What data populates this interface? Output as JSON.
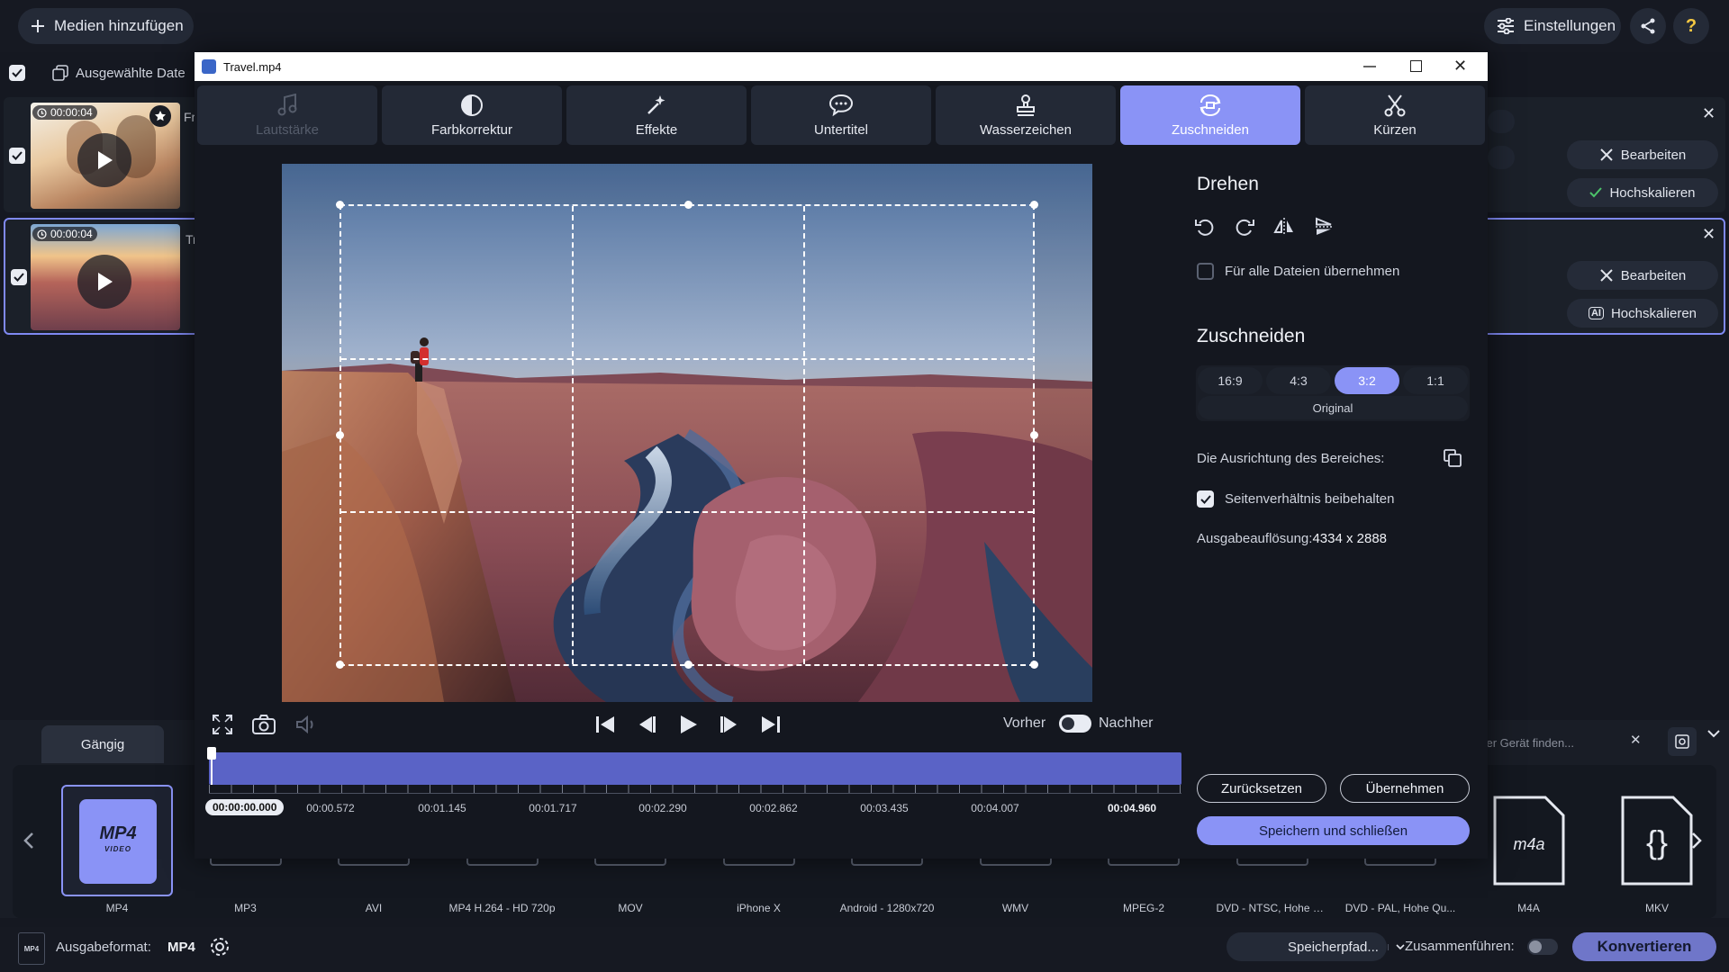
{
  "app": {
    "add_media": "Medien hinzufügen",
    "settings": "Einstellungen",
    "select_all": "Ausgewählte Date",
    "files": [
      {
        "duration": "00:00:04",
        "name": "Fr",
        "edit": "Bearbeiten",
        "upscale": "Hochskalieren"
      },
      {
        "duration": "00:00:04",
        "name": "Tr",
        "edit": "Bearbeiten",
        "upscale": "Hochskalieren"
      }
    ],
    "search_placeholder": "oder Gerät finden...",
    "tab_common": "Gängig",
    "formats": [
      {
        "label": "MP4",
        "icon": "mp4-video-icon"
      },
      {
        "label": "MP3",
        "icon": "mp3-icon"
      },
      {
        "label": "AVI",
        "icon": "avi-icon"
      },
      {
        "label": "MP4 H.264 - HD 720p",
        "icon": "hd-icon"
      },
      {
        "label": "MOV",
        "icon": "mov-icon"
      },
      {
        "label": "iPhone X",
        "icon": "iphone-icon"
      },
      {
        "label": "Android - 1280x720",
        "icon": "android-icon"
      },
      {
        "label": "WMV",
        "icon": "wmv-icon"
      },
      {
        "label": "MPEG-2",
        "icon": "mpeg2-icon"
      },
      {
        "label": "DVD - NTSC, Hohe Q...",
        "icon": "dvd-ntsc-icon"
      },
      {
        "label": "DVD - PAL, Hohe Qu...",
        "icon": "dvd-pal-icon"
      },
      {
        "label": "M4A",
        "icon": "m4a-icon"
      },
      {
        "label": "MKV",
        "icon": "mkv-icon"
      }
    ],
    "output_format_label": "Ausgabeformat:",
    "output_format_value": "MP4",
    "save_path": "Speicherpfad...",
    "merge_label": "Zusammenführen:",
    "convert": "Konvertieren"
  },
  "dialog": {
    "title": "Travel.mp4",
    "tabs": [
      {
        "label": "Lautstärke",
        "icon": "music-note-icon"
      },
      {
        "label": "Farbkorrektur",
        "icon": "contrast-icon"
      },
      {
        "label": "Effekte",
        "icon": "magic-wand-icon"
      },
      {
        "label": "Untertitel",
        "icon": "speech-bubble-icon"
      },
      {
        "label": "Wasserzeichen",
        "icon": "stamp-icon"
      },
      {
        "label": "Zuschneiden",
        "icon": "crop-rotate-icon"
      },
      {
        "label": "Kürzen",
        "icon": "scissors-icon"
      }
    ],
    "active_tab": "Zuschneiden",
    "rotate_title": "Drehen",
    "apply_all": "Für alle Dateien übernehmen",
    "crop_title": "Zuschneiden",
    "ratios": [
      "16:9",
      "4:3",
      "3:2",
      "1:1"
    ],
    "ratio_selected": "3:2",
    "original": "Original",
    "orientation_label": "Die Ausrichtung des Bereiches:",
    "keep_aspect": "Seitenverhältnis beibehalten",
    "output_res_label": "Ausgabeauflösung:",
    "output_res_value": "4334 x 2888",
    "before": "Vorher",
    "after": "Nachher",
    "reset": "Zurücksetzen",
    "apply": "Übernehmen",
    "save_close": "Speichern und schließen",
    "timeline": {
      "current": "00:00:00.000",
      "end": "00:04.960",
      "ticks": [
        "00:00.572",
        "00:01.145",
        "00:01.717",
        "00:02.290",
        "00:02.862",
        "00:03.435",
        "00:04.007"
      ]
    }
  }
}
